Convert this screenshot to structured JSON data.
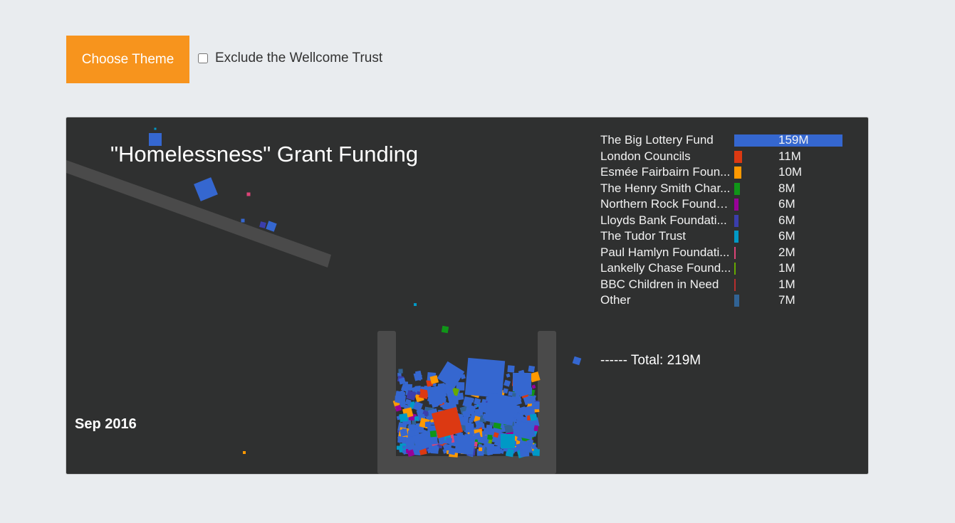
{
  "toolbar": {
    "theme_button": "Choose Theme",
    "exclude_label": "Exclude the Wellcome Trust",
    "exclude_checked": false
  },
  "colors": {
    "accent": "#f7941d",
    "panel": "#2f3030",
    "chute": "#4a4a4a"
  },
  "chart_data": {
    "type": "bar",
    "title": "\"Homelessness\" Grant Funding",
    "date": "Sep 2016",
    "total": "------ Total: 219M",
    "unit": "M",
    "series": [
      {
        "name": "The Big Lottery Fund",
        "value": 159,
        "label": "159M",
        "color": "#3567d0"
      },
      {
        "name": "London Councils",
        "value": 11,
        "label": "11M",
        "color": "#dc3912"
      },
      {
        "name": "Esmée Fairbairn Foun...",
        "value": 10,
        "label": "10M",
        "color": "#ff9900"
      },
      {
        "name": "The Henry Smith Char...",
        "value": 8,
        "label": "8M",
        "color": "#109618"
      },
      {
        "name": "Northern Rock Founda...",
        "value": 6,
        "label": "6M",
        "color": "#990099"
      },
      {
        "name": "Lloyds Bank Foundati...",
        "value": 6,
        "label": "6M",
        "color": "#3b3eac"
      },
      {
        "name": "The Tudor Trust",
        "value": 6,
        "label": "6M",
        "color": "#0099c6"
      },
      {
        "name": "Paul Hamlyn Foundati...",
        "value": 2,
        "label": "2M",
        "color": "#dd4477"
      },
      {
        "name": "Lankelly Chase Found...",
        "value": 1,
        "label": "1M",
        "color": "#66aa00"
      },
      {
        "name": "BBC Children in Need",
        "value": 1,
        "label": "1M",
        "color": "#b82e2e"
      },
      {
        "name": "Other",
        "value": 7,
        "label": "7M",
        "color": "#316395"
      }
    ]
  }
}
